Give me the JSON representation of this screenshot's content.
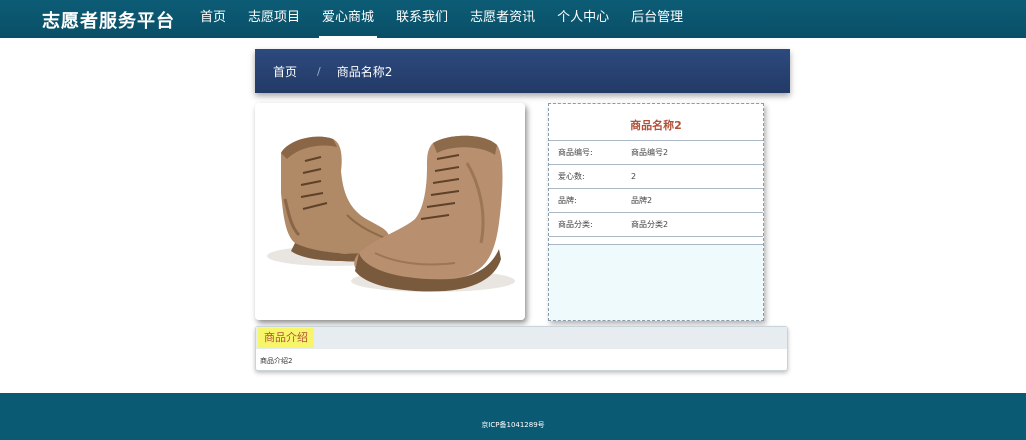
{
  "header": {
    "brand": "志愿者服务平台",
    "nav": [
      "首页",
      "志愿项目",
      "爱心商城",
      "联系我们",
      "志愿者资讯",
      "个人中心",
      "后台管理"
    ],
    "active": "爱心商城"
  },
  "breadcrumb": {
    "home": "首页",
    "separator": "/",
    "current": "商品名称2"
  },
  "product": {
    "image_icon": "boots-image",
    "title": "商品名称2",
    "fields": [
      {
        "label": "商品编号:",
        "value": "商品编号2"
      },
      {
        "label": "爱心数:",
        "value": "2"
      },
      {
        "label": "品牌:",
        "value": "品牌2"
      },
      {
        "label": "商品分类:",
        "value": "商品分类2"
      }
    ]
  },
  "intro": {
    "tab": "商品介绍",
    "content": "商品介绍2"
  },
  "footer": {
    "icp": "京ICP备1041289号"
  },
  "colors": {
    "nav_bg": "#0a4f67",
    "breadcrumb_bg": "#223a66",
    "title_accent": "#b0523a",
    "info_panel_bg": "#eefafc",
    "tab_highlight": "#f7f56a",
    "footer_bg": "#0b5a74"
  }
}
